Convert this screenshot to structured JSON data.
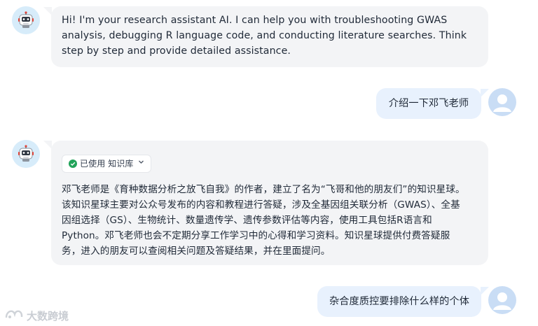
{
  "messages": {
    "intro": "Hi! I'm your research assistant AI. I can help you with troubleshooting GWAS analysis, debugging R language code, and conducting literature searches. Think step by step and provide detailed assistance.",
    "user_q1": "介绍一下邓飞老师",
    "kb_badge": "已使用 知识库",
    "answer_lines": [
      "邓飞老师是《育种数据分析之放飞自我》的作者，建立了名为“飞哥和他的朋友们”的知识星球。",
      "该知识星球主要对公众号发布的内容和教程进行答疑，涉及全基因组关联分析（GWAS）、全基",
      "因组选择（GS）、生物统计、数量遗传学、遗传参数评估等内容，使用工具包括R语言和",
      "Python。邓飞老师也会不定期分享工作学习中的心得和学习资料。知识星球提供付费答疑服",
      "务，进入的朋友可以查阅相关问题及答疑结果，并在里面提问。"
    ],
    "user_q2": "杂合度质控要排除什么样的个体"
  },
  "icons": {
    "bot": "robot-icon",
    "user": "user-icon",
    "check": "check-circle-icon",
    "caret": "chevron-down-icon"
  },
  "watermark": {
    "text": "大数跨境"
  },
  "colors": {
    "bot_bubble": "#f3f4f6",
    "user_bubble": "#e8f1fd",
    "check_green": "#22a35a"
  }
}
